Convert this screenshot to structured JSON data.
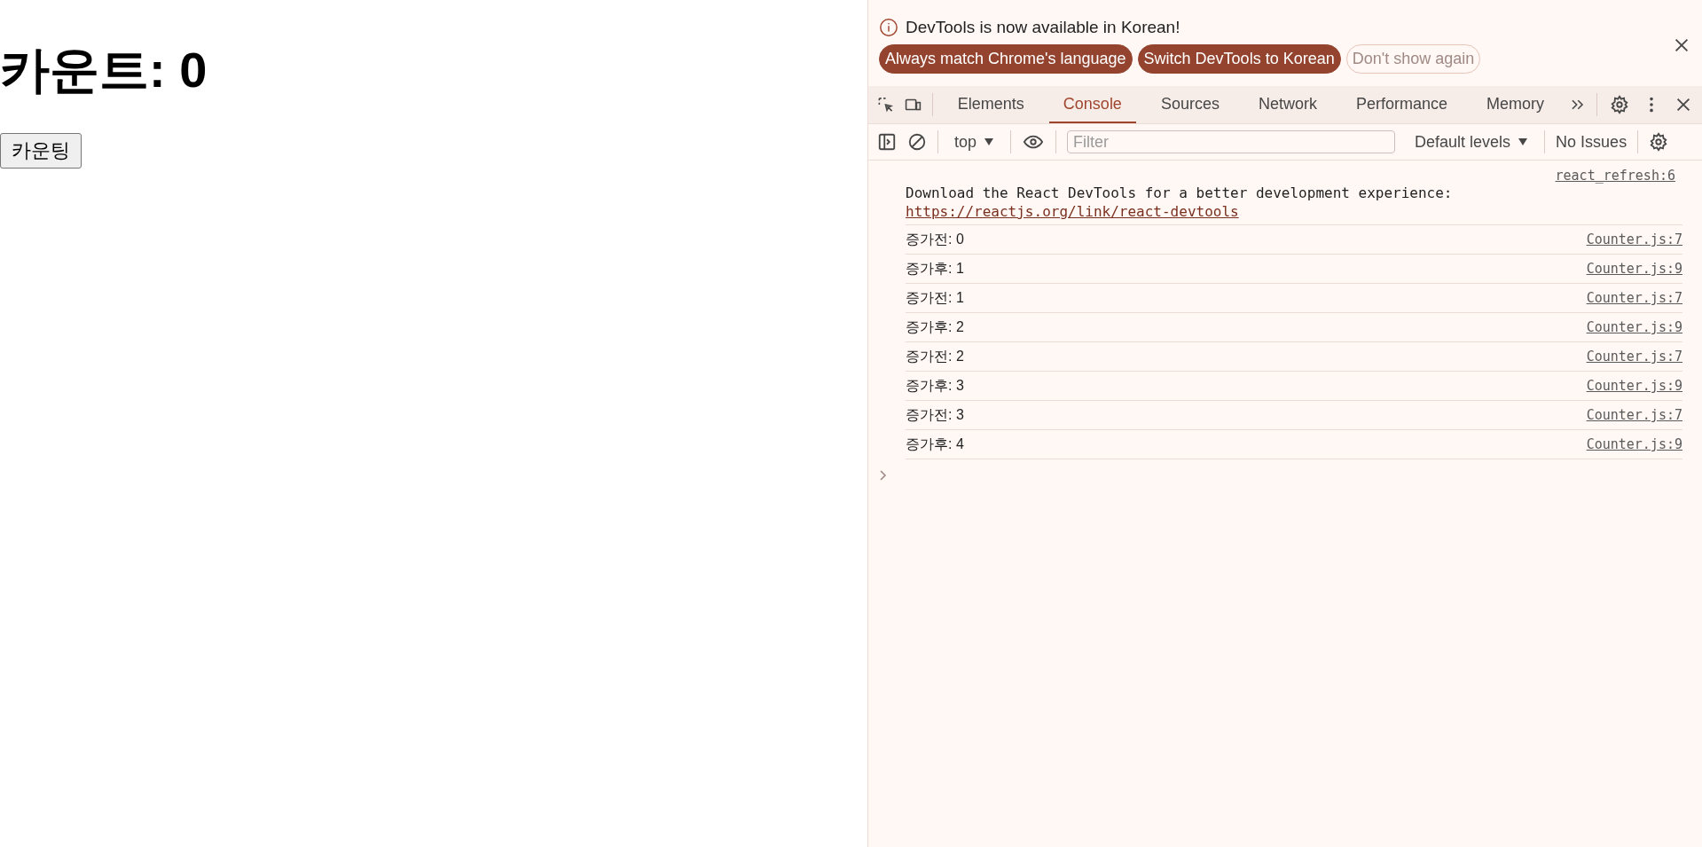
{
  "page": {
    "heading": "카운트: 0",
    "button": "카운팅"
  },
  "devtools": {
    "infobar": {
      "message": "DevTools is now available in Korean!",
      "buttons": [
        {
          "label": "Always match Chrome's language",
          "kind": "primary"
        },
        {
          "label": "Switch DevTools to Korean",
          "kind": "primary"
        },
        {
          "label": "Don't show again",
          "kind": "secondary"
        }
      ]
    },
    "tabs": [
      {
        "label": "Elements",
        "selected": false
      },
      {
        "label": "Console",
        "selected": true
      },
      {
        "label": "Sources",
        "selected": false
      },
      {
        "label": "Network",
        "selected": false
      },
      {
        "label": "Performance",
        "selected": false
      },
      {
        "label": "Memory",
        "selected": false
      }
    ],
    "console_toolbar": {
      "context": "top",
      "filter": {
        "placeholder": "Filter"
      },
      "levels": "Default levels",
      "issues": "No Issues"
    },
    "messages": [
      {
        "kind": "info",
        "source": "react_refresh:6",
        "text": "Download the React DevTools for a better development experience: ",
        "link": "https://reactjs.org/link/react-devtools"
      },
      {
        "kind": "log",
        "text": "증가전: 0",
        "source": "Counter.js:7"
      },
      {
        "kind": "log",
        "text": "증가후: 1",
        "source": "Counter.js:9"
      },
      {
        "kind": "log",
        "text": "증가전: 1",
        "source": "Counter.js:7"
      },
      {
        "kind": "log",
        "text": "증가후: 2",
        "source": "Counter.js:9"
      },
      {
        "kind": "log",
        "text": "증가전: 2",
        "source": "Counter.js:7"
      },
      {
        "kind": "log",
        "text": "증가후: 3",
        "source": "Counter.js:9"
      },
      {
        "kind": "log",
        "text": "증가전: 3",
        "source": "Counter.js:7"
      },
      {
        "kind": "log",
        "text": "증가후: 4",
        "source": "Counter.js:9"
      }
    ]
  }
}
